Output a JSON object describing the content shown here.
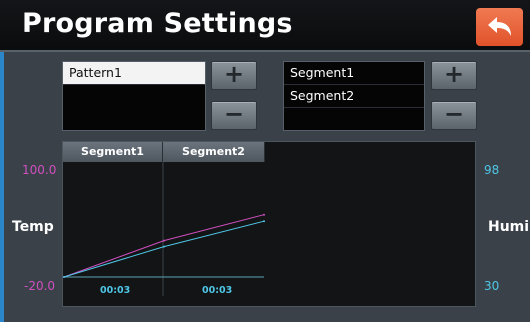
{
  "header": {
    "title": "Program Settings"
  },
  "patterns": {
    "items": [
      "Pattern1"
    ]
  },
  "segments": {
    "items": [
      "Segment1",
      "Segment2"
    ]
  },
  "buttons": {
    "add_label": "+",
    "remove_label": "−"
  },
  "chart": {
    "segment_headers": [
      "Segment1",
      "Segment2"
    ],
    "temp_axis": {
      "label": "Temp",
      "max": "100.0",
      "min": "-20.0",
      "color": "#d14fbf"
    },
    "humi_axis": {
      "label": "Humi",
      "max": "98",
      "min": "30",
      "color": "#4fc6e6"
    },
    "time_labels": [
      "00:03",
      "00:03"
    ]
  },
  "chart_data": {
    "type": "line",
    "x": [
      0,
      1,
      2
    ],
    "xlabel": "",
    "series": [
      {
        "name": "Temp",
        "axis": "left",
        "color": "#d14fbf",
        "values": [
          -20.0,
          18.0,
          45.0
        ]
      },
      {
        "name": "Humi",
        "axis": "right",
        "color": "#4fc6e6",
        "values": [
          30,
          48,
          63
        ]
      }
    ],
    "ylim_left": [
      -20.0,
      100.0
    ],
    "ylim_right": [
      30,
      98
    ],
    "ylabel_left": "Temp",
    "ylabel_right": "Humi",
    "x_tick_labels": [
      "00:03",
      "00:03"
    ]
  }
}
